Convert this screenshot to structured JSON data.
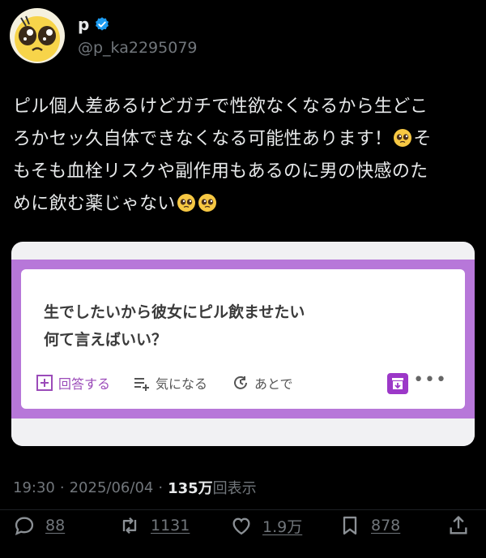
{
  "author": {
    "name": "p",
    "handle": "@p_ka2295079"
  },
  "tweet": {
    "text_line1": "ピル個人差あるけどガチで性欲なくなるから生どこ",
    "text_line2a": "ろかセッ久自体できなくなる可能性あります！",
    "text_line2b": "そ",
    "text_line3": "もそも血栓リスクや副作用もあるのに男の快感のた",
    "text_line4": "めに飲む薬じゃない"
  },
  "media": {
    "question_line1": "生でしたいから彼女にピル飲ませたい",
    "question_line2": "何て言えばいい？",
    "answer_label": "回答する",
    "interest_label": "気になる",
    "later_label": "あとで",
    "more_label": "•••"
  },
  "meta": {
    "time": "19:30",
    "sep1": "·",
    "date": "2025/06/04",
    "sep2": "·",
    "views_count": "135万",
    "views_label": "回表示"
  },
  "actions": {
    "replies": "88",
    "reposts": "1131",
    "likes": "1.9万",
    "bookmarks": "878"
  },
  "colors": {
    "background": "#000000",
    "text": "#e7e9ea",
    "secondary": "#71767b",
    "verified": "#1d9bf0",
    "media_accent": "#b777d9"
  },
  "icons": [
    "verified-badge-icon",
    "pleading-face-emoji",
    "add-answer-icon",
    "interest-list-icon",
    "later-clock-icon",
    "archive-box-icon",
    "reply-icon",
    "repost-icon",
    "like-icon",
    "bookmark-icon",
    "share-icon"
  ]
}
